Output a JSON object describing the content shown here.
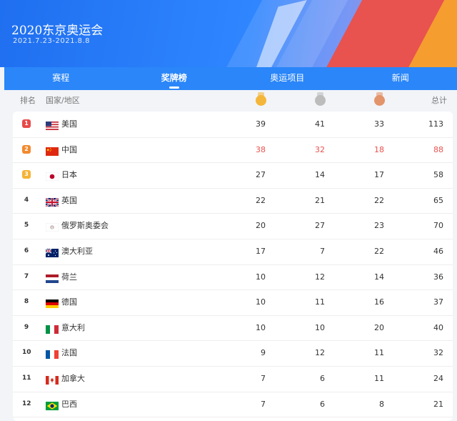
{
  "header": {
    "title": "2020东京奥运会",
    "dates": "2021.7.23-2021.8.8"
  },
  "tabs": [
    {
      "label": "赛程",
      "active": false
    },
    {
      "label": "奖牌榜",
      "active": true
    },
    {
      "label": "奥运项目",
      "active": false
    },
    {
      "label": "新闻",
      "active": false
    }
  ],
  "columns": {
    "rank": "排名",
    "country": "国家/地区",
    "gold_icon": "gold-medal-icon",
    "silver_icon": "silver-medal-icon",
    "bronze_icon": "bronze-medal-icon",
    "total": "总计"
  },
  "colors": {
    "accent": "#2a86f9",
    "highlight": "#e8524f",
    "rank1": "#e84a4a",
    "rank2": "#f28a2e",
    "rank3": "#f5b335"
  },
  "rows": [
    {
      "rank": "1",
      "country": "美国",
      "flag": "us-flag",
      "gold": "39",
      "silver": "41",
      "bronze": "33",
      "total": "113"
    },
    {
      "rank": "2",
      "country": "中国",
      "flag": "cn-flag",
      "gold": "38",
      "silver": "32",
      "bronze": "18",
      "total": "88",
      "highlight": true
    },
    {
      "rank": "3",
      "country": "日本",
      "flag": "jp-flag",
      "gold": "27",
      "silver": "14",
      "bronze": "17",
      "total": "58"
    },
    {
      "rank": "4",
      "country": "英国",
      "flag": "gb-flag",
      "gold": "22",
      "silver": "21",
      "bronze": "22",
      "total": "65"
    },
    {
      "rank": "5",
      "country": "俄罗斯奥委会",
      "flag": "roc-flag",
      "gold": "20",
      "silver": "27",
      "bronze": "23",
      "total": "70"
    },
    {
      "rank": "6",
      "country": "澳大利亚",
      "flag": "au-flag",
      "gold": "17",
      "silver": "7",
      "bronze": "22",
      "total": "46"
    },
    {
      "rank": "7",
      "country": "荷兰",
      "flag": "nl-flag",
      "gold": "10",
      "silver": "12",
      "bronze": "14",
      "total": "36"
    },
    {
      "rank": "8",
      "country": "德国",
      "flag": "de-flag",
      "gold": "10",
      "silver": "11",
      "bronze": "16",
      "total": "37"
    },
    {
      "rank": "9",
      "country": "意大利",
      "flag": "it-flag",
      "gold": "10",
      "silver": "10",
      "bronze": "20",
      "total": "40"
    },
    {
      "rank": "10",
      "country": "法国",
      "flag": "fr-flag",
      "gold": "9",
      "silver": "12",
      "bronze": "11",
      "total": "32"
    },
    {
      "rank": "11",
      "country": "加拿大",
      "flag": "ca-flag",
      "gold": "7",
      "silver": "6",
      "bronze": "11",
      "total": "24"
    },
    {
      "rank": "12",
      "country": "巴西",
      "flag": "br-flag",
      "gold": "7",
      "silver": "6",
      "bronze": "8",
      "total": "21"
    }
  ]
}
